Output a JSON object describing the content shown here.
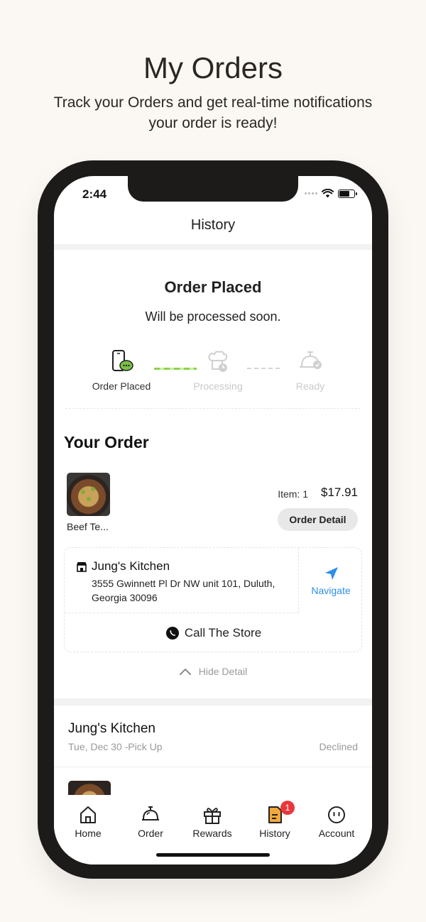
{
  "promo": {
    "title": "My Orders",
    "subtitle": "Track your Orders and get real-time notifications your order is ready!"
  },
  "status_bar": {
    "time": "2:44"
  },
  "nav": {
    "title": "History"
  },
  "order_status": {
    "title": "Order Placed",
    "subtitle": "Will be processed soon.",
    "steps": [
      {
        "label": "Order Placed",
        "state": "active",
        "icon": "phone-chat-icon"
      },
      {
        "label": "Processing",
        "state": "inactive",
        "icon": "chef-clock-icon"
      },
      {
        "label": "Ready",
        "state": "inactive",
        "icon": "cloche-check-icon"
      }
    ]
  },
  "your_order": {
    "heading": "Your Order",
    "item": {
      "name": "Beef Te...",
      "quantity": "Item: 1",
      "price": "$17.91"
    },
    "detail_button": "Order Detail"
  },
  "store": {
    "name": "Jung's Kitchen",
    "address": "3555 Gwinnett Pl Dr NW unit 101, Duluth, Georgia 30096",
    "navigate_label": "Navigate",
    "call_label": "Call The Store"
  },
  "hide_detail": "Hide Detail",
  "history_entry": {
    "store": "Jung's Kitchen",
    "date": "Tue, Dec 30 -Pick Up",
    "status": "Declined"
  },
  "tabs": [
    {
      "label": "Home",
      "icon": "home-icon"
    },
    {
      "label": "Order",
      "icon": "cloche-icon"
    },
    {
      "label": "Rewards",
      "icon": "gift-icon"
    },
    {
      "label": "History",
      "icon": "history-doc-icon",
      "badge": "1"
    },
    {
      "label": "Account",
      "icon": "account-face-icon"
    }
  ],
  "colors": {
    "accent_blue": "#2e8fe8",
    "progress_green": "#8bd14a",
    "badge_red": "#e8383b",
    "history_icon_orange": "#f2a93b"
  }
}
